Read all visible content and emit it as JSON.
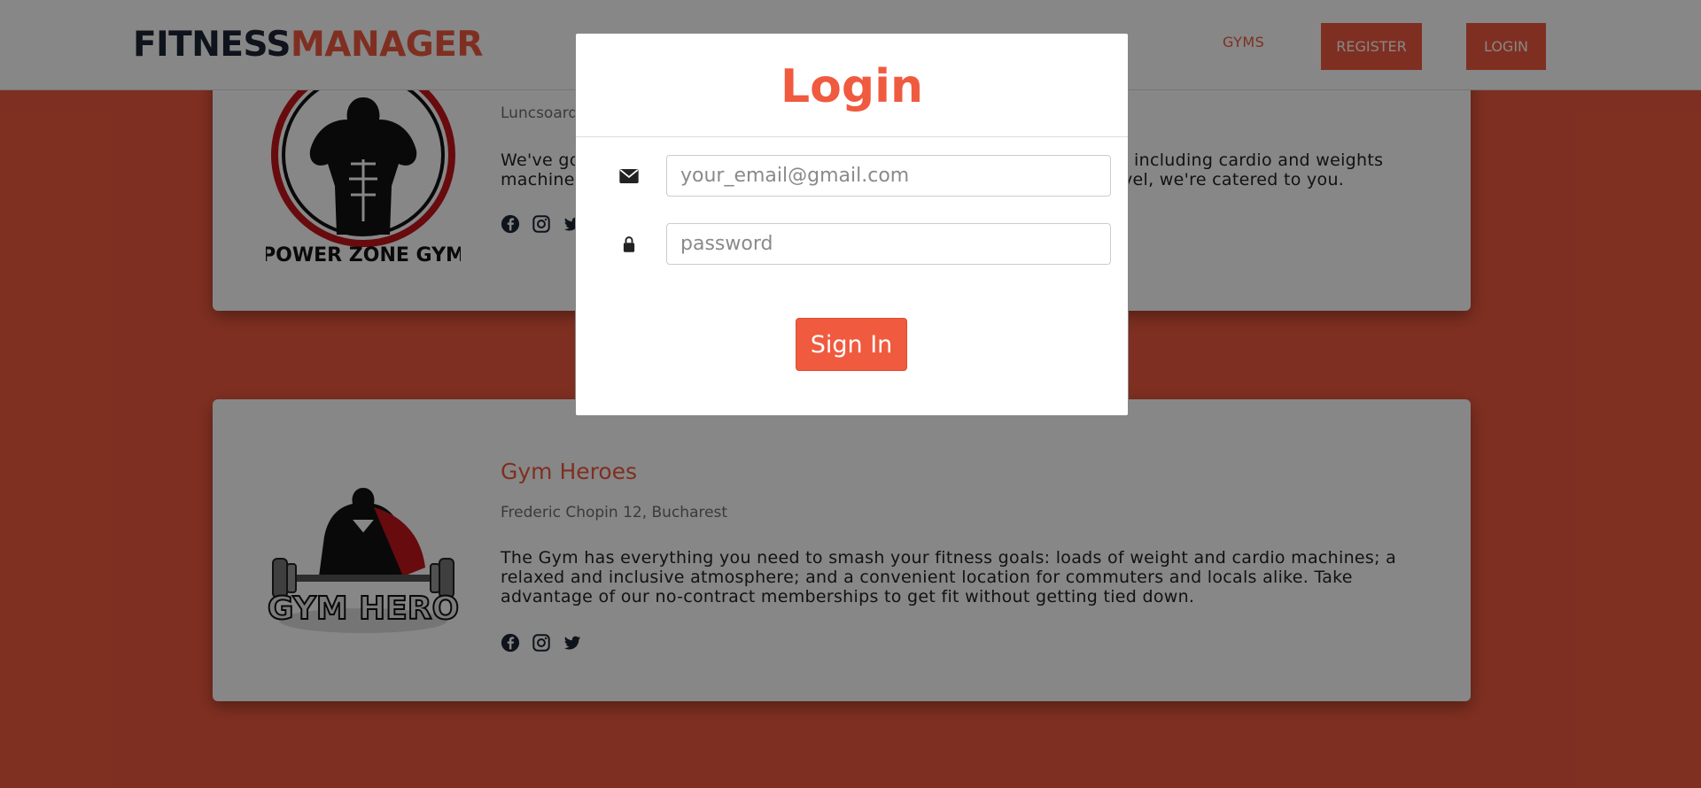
{
  "header": {
    "brand_part1": "FITNESS",
    "brand_part2": "MANAGER",
    "nav": {
      "gyms": "GYMS",
      "register": "REGISTER",
      "login": "LOGIN"
    }
  },
  "gyms": [
    {
      "name": "",
      "address": "Luncsoard",
      "description_visible_left": "We've go\nmachine",
      "description_visible_right": "n, including cardio and weights\nevel, we're catered to you.",
      "logo_text": "POWER ZONE GYM"
    },
    {
      "name": "Gym Heroes",
      "address": "Frederic Chopin 12, Bucharest",
      "description": "The Gym has everything you need to smash your fitness goals: loads of weight and cardio machines; a relaxed and inclusive atmosphere; and a convenient location for commuters and locals alike. Take advantage of our no-contract memberships to get fit without getting tied down.",
      "logo_text": "GYM HERO"
    }
  ],
  "login_modal": {
    "title": "Login",
    "email_placeholder": "your_email@gmail.com",
    "password_placeholder": "password",
    "submit_label": "Sign In"
  },
  "colors": {
    "accent": "#f05a3f",
    "brand_dark": "#1d2433"
  },
  "icons": [
    "envelope-icon",
    "lock-icon",
    "facebook-icon",
    "instagram-icon",
    "twitter-icon"
  ]
}
